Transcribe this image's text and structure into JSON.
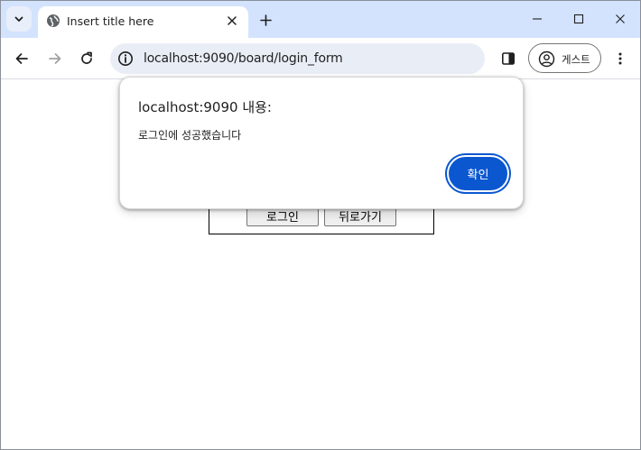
{
  "browser": {
    "tab": {
      "title": "Insert title here"
    },
    "address_bar": {
      "url": "localhost:9090/board/login_form"
    },
    "profile": {
      "label": "게스트"
    }
  },
  "page": {
    "buttons": {
      "login": "로그인",
      "back": "뒤로가기"
    }
  },
  "alert": {
    "title": "localhost:9090 내용:",
    "message": "로그인에 성공했습니다",
    "ok_label": "확인"
  },
  "colors": {
    "tabstrip": "#d3e3fd",
    "omnibox": "#e9eef6",
    "primary_button": "#0b57d0"
  }
}
